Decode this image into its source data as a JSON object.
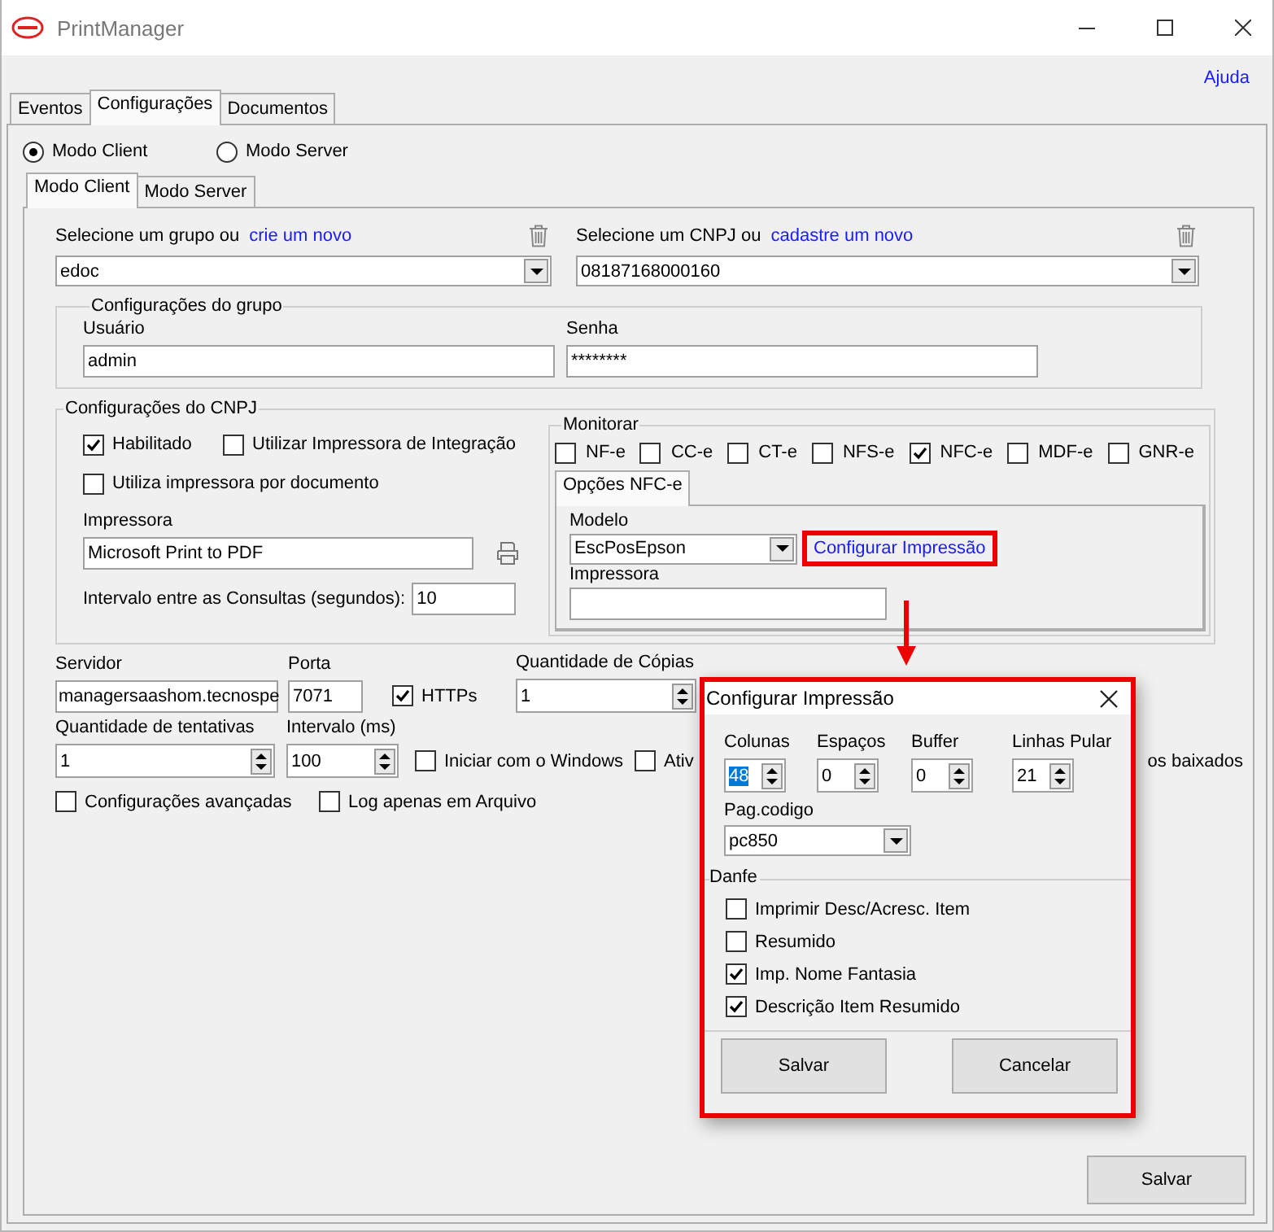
{
  "window": {
    "title": "PrintManager"
  },
  "help_link": "Ajuda",
  "tabs": [
    {
      "label": "Eventos",
      "selected": false
    },
    {
      "label": "Configurações",
      "selected": true
    },
    {
      "label": "Documentos",
      "selected": false
    }
  ],
  "modes": [
    {
      "label": "Modo Client",
      "selected": true
    },
    {
      "label": "Modo Server",
      "selected": false
    }
  ],
  "mode_tabs": [
    {
      "label": "Modo Client",
      "selected": true
    },
    {
      "label": "Modo Server",
      "selected": false
    }
  ],
  "group_select": {
    "label": "Selecione um grupo ou",
    "link": "crie um novo",
    "value": "edoc"
  },
  "cnpj_select": {
    "label": "Selecione um CNPJ ou",
    "link": "cadastre um novo",
    "value": "08187168000160"
  },
  "group_settings": {
    "title": "Configurações do grupo",
    "user_label": "Usuário",
    "user": "admin",
    "password_label": "Senha",
    "password": "********"
  },
  "cnpj_settings": {
    "title": "Configurações do CNPJ",
    "options": [
      {
        "label": "Habilitado",
        "checked": true
      },
      {
        "label": "Utilizar Impressora de Integração",
        "checked": false
      },
      {
        "label": "Utiliza impressora por documento",
        "checked": false
      }
    ],
    "printer_label": "Impressora",
    "printer": "Microsoft Print to PDF",
    "interval_label": "Intervalo entre as Consultas (segundos):",
    "interval": "10"
  },
  "monitor": {
    "title": "Monitorar",
    "documents": [
      {
        "label": "NF-e",
        "checked": false
      },
      {
        "label": "CC-e",
        "checked": false
      },
      {
        "label": "CT-e",
        "checked": false
      },
      {
        "label": "NFS-e",
        "checked": false
      },
      {
        "label": "NFC-e",
        "checked": true
      },
      {
        "label": "MDF-e",
        "checked": false
      },
      {
        "label": "GNR-e",
        "checked": false
      }
    ],
    "tab": "Opções NFC-e",
    "model_label": "Modelo",
    "model": "EscPosEpson",
    "configure_link": "Configurar Impressão",
    "printer_label": "Impressora"
  },
  "connection": {
    "server_label": "Servidor",
    "server": "managersaashom.tecnospe",
    "port_label": "Porta",
    "port": "7071",
    "https": {
      "label": "HTTPs",
      "checked": true
    },
    "copies_label": "Quantidade de Cópias",
    "copies": "1",
    "attempts_label": "Quantidade de tentativas",
    "attempts": "1",
    "interval_label": "Intervalo (ms)",
    "interval": "100",
    "startup": {
      "label": "Iniciar com o Windows",
      "checked": false
    },
    "partial_option": {
      "label": "Ativ",
      "checked": false
    },
    "partial_text": "os baixados"
  },
  "options": [
    {
      "label": "Configurações avançadas",
      "checked": false
    },
    {
      "label": "Log apenas em Arquivo",
      "checked": false
    }
  ],
  "save_button": "Salvar",
  "dialog": {
    "title": "Configurar Impressão",
    "spinners": [
      {
        "label": "Colunas",
        "value": "48",
        "selected": true
      },
      {
        "label": "Espaços",
        "value": "0",
        "selected": false
      },
      {
        "label": "Buffer",
        "value": "0",
        "selected": false
      },
      {
        "label": "Linhas Pular",
        "value": "21",
        "selected": false
      }
    ],
    "codepage_label": "Pag.codigo",
    "codepage": "pc850",
    "danfe_title": "Danfe",
    "danfe_options": [
      {
        "label": "Imprimir Desc/Acresc. Item",
        "checked": false
      },
      {
        "label": "Resumido",
        "checked": false
      },
      {
        "label": "Imp. Nome Fantasia",
        "checked": true
      },
      {
        "label": "Descrição Item Resumido",
        "checked": true
      }
    ],
    "buttons": [
      "Salvar",
      "Cancelar"
    ]
  }
}
